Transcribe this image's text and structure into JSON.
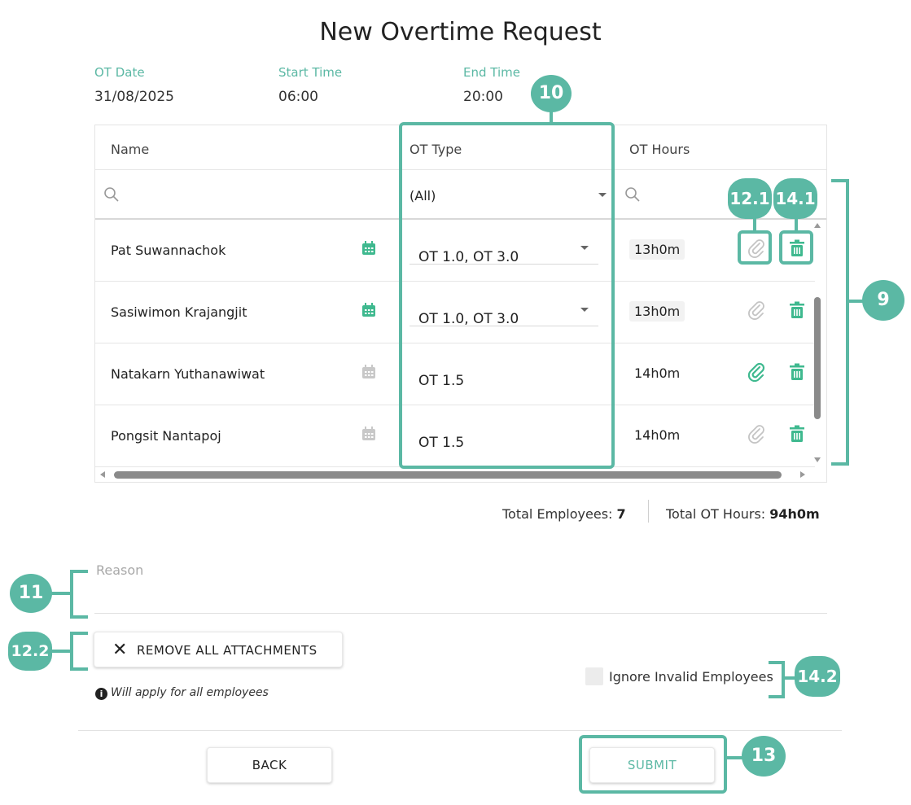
{
  "page": {
    "title": "New Overtime Request"
  },
  "meta": {
    "ot_date_label": "OT Date",
    "ot_date_value": "31/08/2025",
    "start_label": "Start Time",
    "start_value": "06:00",
    "end_label": "End Time",
    "end_value": "20:00"
  },
  "grid": {
    "columns": {
      "name": "Name",
      "ot_type": "OT Type",
      "ot_hours": "OT Hours"
    },
    "filter_ot_type": "(All)",
    "rows": [
      {
        "name": "Pat Suwannachok",
        "ot_type": "OT 1.0, OT 3.0",
        "hours": "13h0m"
      },
      {
        "name": "Sasiwimon Krajangjit",
        "ot_type": "OT 1.0, OT 3.0",
        "hours": "13h0m"
      },
      {
        "name": "Natakarn Yuthanawiwat",
        "ot_type": "OT 1.5",
        "hours": "14h0m"
      },
      {
        "name": "Pongsit Nantapoj",
        "ot_type": "OT 1.5",
        "hours": "14h0m"
      }
    ]
  },
  "totals": {
    "employees_label": "Total Employees:",
    "employees_value": "7",
    "hours_label": "Total OT Hours:",
    "hours_value": "94h0m"
  },
  "reason": {
    "placeholder": "Reason"
  },
  "remove_button": "REMOVE ALL ATTACHMENTS",
  "note": "Will apply for all employees",
  "ignore_label": "Ignore Invalid Employees",
  "back_button": "BACK",
  "submit_button": "SUBMIT",
  "callouts": {
    "c9": "9",
    "c10": "10",
    "c11": "11",
    "c12_1": "12.1",
    "c12_2": "12.2",
    "c13": "13",
    "c14_1": "14.1",
    "c14_2": "14.2"
  },
  "colors": {
    "accent": "#5bb8a4",
    "calendar_active": "#3fb98f",
    "calendar_inactive": "#c8c8c8",
    "icon_inactive": "#c4c4c4"
  }
}
